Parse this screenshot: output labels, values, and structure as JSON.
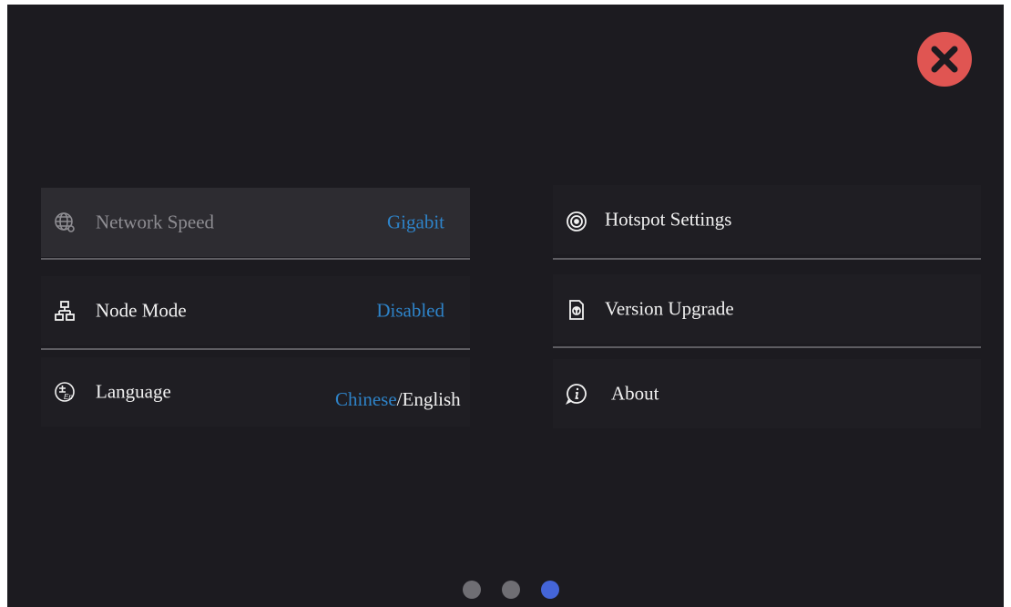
{
  "close": {
    "icon": "close-icon",
    "color": "#e05552"
  },
  "left_settings": {
    "network_speed": {
      "label": "Network Speed",
      "value": "Gigabit",
      "icon": "globe-icon"
    },
    "node_mode": {
      "label": "Node Mode",
      "value": "Disabled",
      "icon": "network-nodes-icon"
    },
    "language": {
      "label": "Language",
      "icon": "language-icon",
      "options": [
        "Chinese",
        "English"
      ],
      "separator": "/",
      "selected": "Chinese"
    }
  },
  "right_settings": {
    "hotspot": {
      "label": "Hotspot Settings",
      "icon": "hotspot-icon"
    },
    "version_upgrade": {
      "label": "Version Upgrade",
      "icon": "upgrade-icon"
    },
    "about": {
      "label": "About",
      "icon": "info-icon"
    }
  },
  "pagination": {
    "total": 3,
    "current": 3
  },
  "colors": {
    "background": "#1c1b20",
    "accent_value": "#2e83c8",
    "active_dot": "#4465d8",
    "inactive_dot": "#6f6e73"
  }
}
